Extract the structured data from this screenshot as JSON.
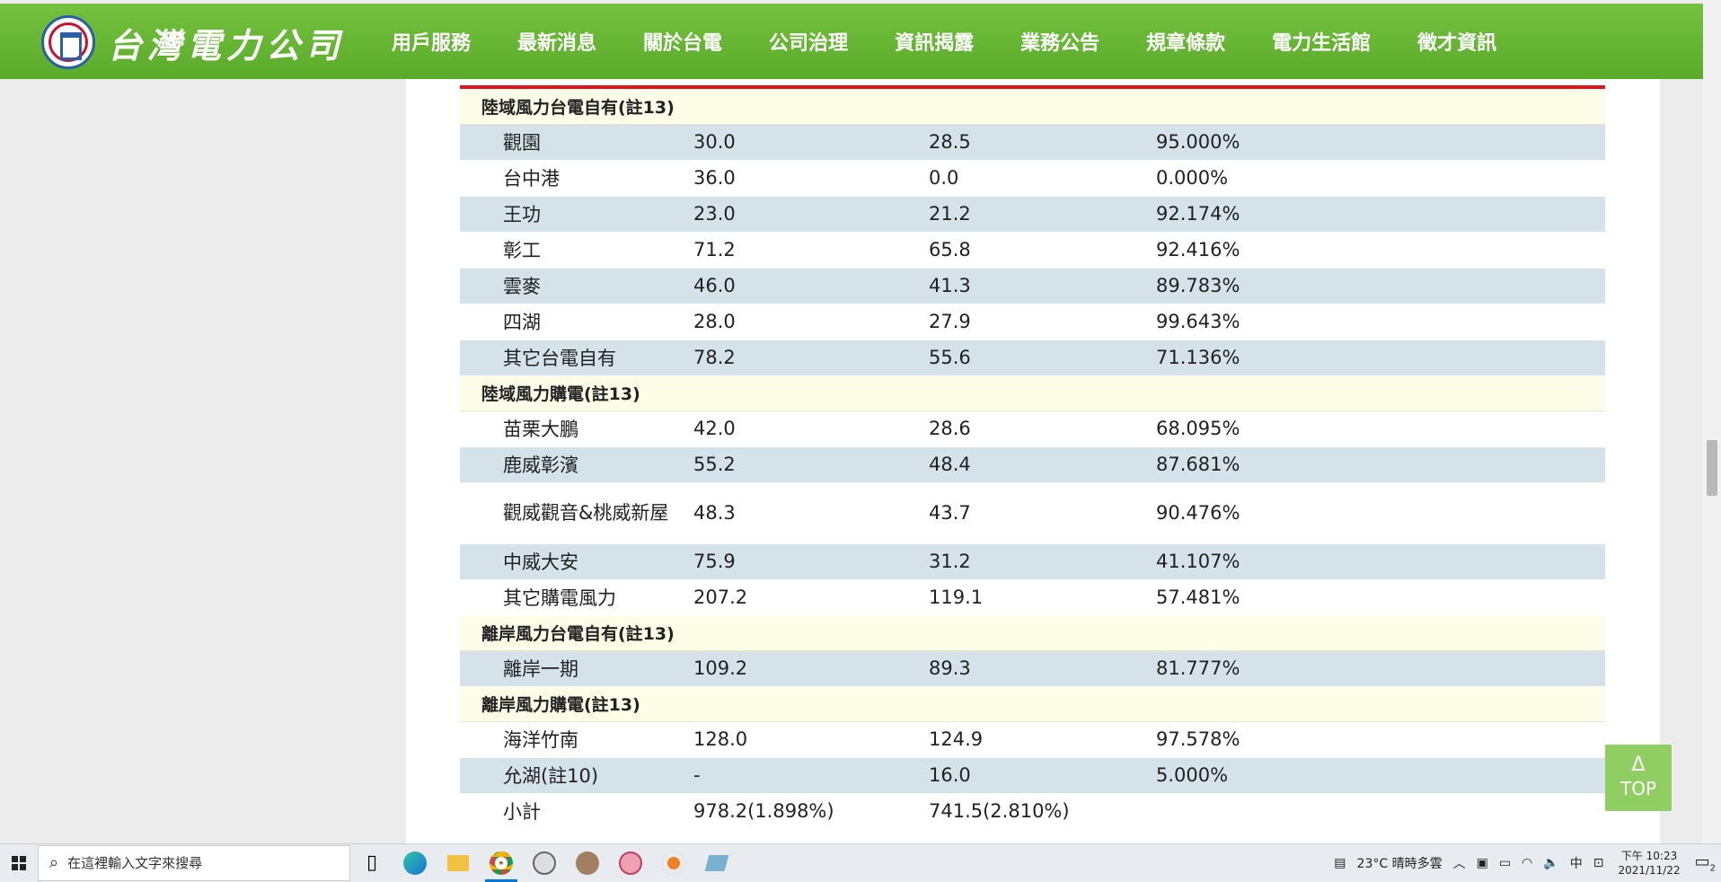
{
  "header": {
    "logo_text": "台灣電力公司",
    "nav": [
      "用戶服務",
      "最新消息",
      "關於台電",
      "公司治理",
      "資訊揭露",
      "業務公告",
      "規章條款",
      "電力生活館",
      "徵才資訊"
    ],
    "active_nav_index": 4
  },
  "table": {
    "rows": [
      {
        "type": "group",
        "label": "陸域風力台電自有(註13)"
      },
      {
        "type": "shade",
        "name": "觀園",
        "capacity": "30.0",
        "generation": "28.5",
        "ratio": "95.000%"
      },
      {
        "type": "plain",
        "name": "台中港",
        "capacity": "36.0",
        "generation": "0.0",
        "ratio": "0.000%"
      },
      {
        "type": "shade",
        "name": "王功",
        "capacity": "23.0",
        "generation": "21.2",
        "ratio": "92.174%"
      },
      {
        "type": "plain",
        "name": "彰工",
        "capacity": "71.2",
        "generation": "65.8",
        "ratio": "92.416%"
      },
      {
        "type": "shade",
        "name": "雲麥",
        "capacity": "46.0",
        "generation": "41.3",
        "ratio": "89.783%"
      },
      {
        "type": "plain",
        "name": "四湖",
        "capacity": "28.0",
        "generation": "27.9",
        "ratio": "99.643%"
      },
      {
        "type": "shade",
        "name": "其它台電自有",
        "capacity": "78.2",
        "generation": "55.6",
        "ratio": "71.136%"
      },
      {
        "type": "group",
        "label": "陸域風力購電(註13)"
      },
      {
        "type": "plain",
        "name": "苗栗大鵬",
        "capacity": "42.0",
        "generation": "28.6",
        "ratio": "68.095%"
      },
      {
        "type": "shade",
        "name": "鹿威彰濱",
        "capacity": "55.2",
        "generation": "48.4",
        "ratio": "87.681%"
      },
      {
        "type": "plain tall",
        "name": "觀威觀音&桃威新屋",
        "capacity": "48.3",
        "generation": "43.7",
        "ratio": "90.476%"
      },
      {
        "type": "shade",
        "name": "中威大安",
        "capacity": "75.9",
        "generation": "31.2",
        "ratio": "41.107%"
      },
      {
        "type": "plain",
        "name": "其它購電風力",
        "capacity": "207.2",
        "generation": "119.1",
        "ratio": "57.481%"
      },
      {
        "type": "group",
        "label": "離岸風力台電自有(註13)"
      },
      {
        "type": "shade",
        "name": "離岸一期",
        "capacity": "109.2",
        "generation": "89.3",
        "ratio": "81.777%"
      },
      {
        "type": "group",
        "label": "離岸風力購電(註13)"
      },
      {
        "type": "plain",
        "name": "海洋竹南",
        "capacity": "128.0",
        "generation": "124.9",
        "ratio": "97.578%"
      },
      {
        "type": "shade",
        "name": "允湖(註10)",
        "capacity": "-",
        "generation": "16.0",
        "ratio": "5.000%"
      },
      {
        "type": "plain",
        "name": "小計",
        "capacity": "978.2(1.898%)",
        "generation": "741.5(2.810%)",
        "ratio": ""
      }
    ]
  },
  "top_button": {
    "arrow": "Δ",
    "label": "TOP"
  },
  "taskbar": {
    "search_placeholder": "在這裡輸入文字來搜尋",
    "weather": "23°C  晴時多雲",
    "ime": "中",
    "time": "下午 10:23",
    "date": "2021/11/22",
    "notification_count": "2"
  }
}
